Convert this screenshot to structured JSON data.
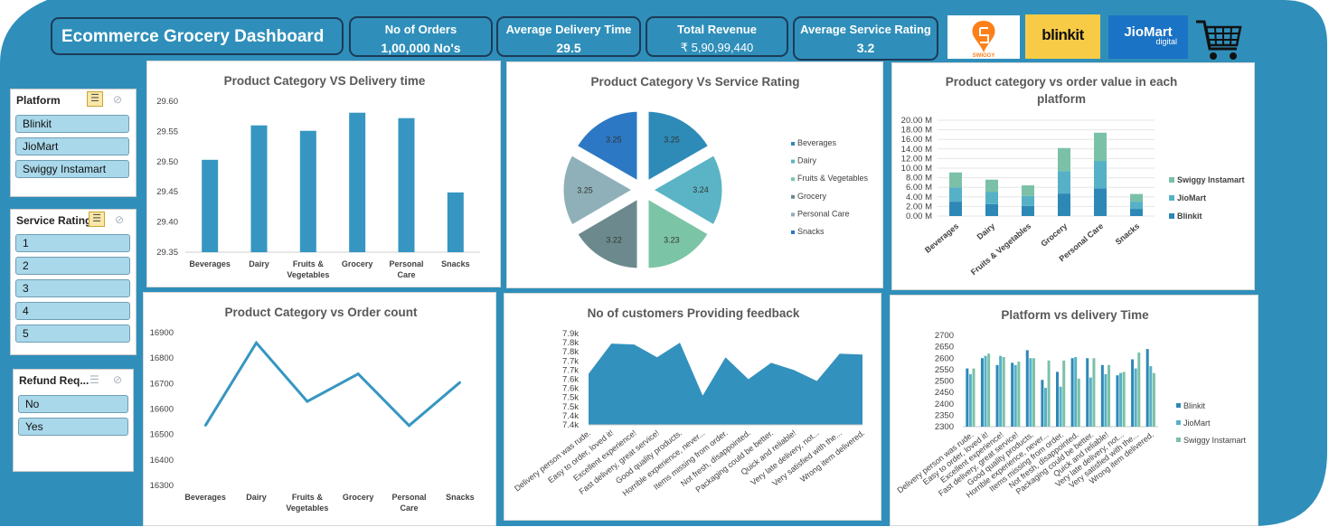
{
  "header": {
    "title": "Ecommerce Grocery Dashboard",
    "kpis": [
      {
        "label": "No of Orders",
        "value": "1,00,000 No's"
      },
      {
        "label": "Average Delivery Time",
        "value": "29.5"
      },
      {
        "label": "Total Revenue",
        "value": "₹ 5,90,99,440"
      },
      {
        "label": "Average Service Rating",
        "value": "3.2"
      }
    ],
    "logos": {
      "swiggy": "SWIGGY",
      "blinkit": "blinkit",
      "jiomart": "JioMart",
      "jiomart_sub": "digital"
    },
    "cart_icon": "shopping-cart-icon"
  },
  "slicers": {
    "platform": {
      "title": "Platform",
      "items": [
        "Blinkit",
        "JioMart",
        "Swiggy Instamart"
      ]
    },
    "service_rating": {
      "title": "Service Rating",
      "items": [
        "1",
        "2",
        "3",
        "4",
        "5"
      ]
    },
    "refund": {
      "title": "Refund Req...",
      "items": [
        "No",
        "Yes"
      ]
    }
  },
  "colors": {
    "accent": "#2f8fba",
    "dark": "#1c3b58",
    "bar": "#3696c1",
    "slicer_item": "#a9d8ea"
  },
  "chart_data": [
    {
      "type": "bar",
      "title": "Product Category VS Delivery time",
      "categories": [
        "Beverages",
        "Dairy",
        "Fruits & Vegetables",
        "Grocery",
        "Personal Care",
        "Snacks"
      ],
      "values": [
        29.503,
        29.56,
        29.551,
        29.581,
        29.572,
        29.449
      ],
      "ylim": [
        29.35,
        29.6
      ],
      "yticks": [
        "29.60",
        "29.55",
        "29.50",
        "29.45",
        "29.40",
        "29.35"
      ],
      "grid": false
    },
    {
      "type": "pie",
      "title": "Product Category Vs Service Rating",
      "categories": [
        "Beverages",
        "Dairy",
        "Fruits & Vegetables",
        "Grocery",
        "Personal Care",
        "Snacks"
      ],
      "values": [
        3.25,
        3.24,
        3.23,
        3.22,
        3.25,
        3.25
      ],
      "labels": [
        "3.25",
        "3.24",
        "3.23",
        "3.22",
        "3.25",
        "3.25"
      ],
      "colors": [
        "#2e8bb8",
        "#5ab4c5",
        "#7cc4a6",
        "#6c8a8e",
        "#8fb0b8",
        "#2c78c4"
      ],
      "legend": "right"
    },
    {
      "type": "bar",
      "stacked": true,
      "title": "Product category vs order value in each platform",
      "categories": [
        "Beverages",
        "Dairy",
        "Fruits & Vegetables",
        "Grocery",
        "Personal Care",
        "Snacks"
      ],
      "series": [
        {
          "name": "Blinkit",
          "values": [
            3.0,
            2.5,
            2.1,
            4.7,
            5.8,
            1.5
          ]
        },
        {
          "name": "JioMart",
          "values": [
            3.0,
            2.5,
            2.1,
            4.7,
            5.7,
            1.5
          ]
        },
        {
          "name": "Swiggy Instamart",
          "values": [
            3.1,
            2.6,
            2.2,
            4.8,
            5.9,
            1.6
          ]
        }
      ],
      "colors": [
        "#2e88b6",
        "#56b1c7",
        "#7bc1a7"
      ],
      "ylim": [
        0,
        20
      ],
      "yticks": [
        "20.00 M",
        "18.00 M",
        "16.00 M",
        "14.00 M",
        "12.00 M",
        "10.00 M",
        "8.00 M",
        "6.00 M",
        "4.00 M",
        "2.00 M",
        "0.00 M"
      ],
      "legend": "right"
    },
    {
      "type": "line",
      "title": "Product Category vs Order count",
      "categories": [
        "Beverages",
        "Dairy",
        "Fruits & Vegetables",
        "Grocery",
        "Personal Care",
        "Snacks"
      ],
      "values": [
        16535,
        16860,
        16630,
        16738,
        16535,
        16705
      ],
      "ylim": [
        16300,
        16900
      ],
      "yticks": [
        "16900",
        "16800",
        "16700",
        "16600",
        "16500",
        "16400",
        "16300"
      ]
    },
    {
      "type": "area",
      "title": "No of customers Providing feedback",
      "categories": [
        "Delivery person was rude.",
        "Easy to order, loved it!",
        "Excellent experience!",
        "Fast delivery, great service!",
        "Good quality products.",
        "Horrible experience, never...",
        "Items missing from order.",
        "Not fresh, disappointed.",
        "Packaging could be better.",
        "Quick and reliable!",
        "Very late delivery, not...",
        "Very satisfied with the...",
        "Wrong item delivered."
      ],
      "values": [
        7680,
        7845,
        7840,
        7770,
        7850,
        7560,
        7770,
        7650,
        7740,
        7700,
        7640,
        7790,
        7785
      ],
      "ylim": [
        7400,
        7900
      ],
      "yticks": [
        "7.9k",
        "7.8k",
        "7.8k",
        "7.7k",
        "7.7k",
        "7.6k",
        "7.6k",
        "7.5k",
        "7.5k",
        "7.4k",
        "7.4k"
      ]
    },
    {
      "type": "bar",
      "title": "Platform vs delivery Time",
      "categories": [
        "Delivery person was rude.",
        "Easy to order, loved it!",
        "Excellent experience!",
        "Fast delivery, great service!",
        "Good quality products.",
        "Horrible experience, never...",
        "Items missing from order.",
        "Not fresh, disappointed.",
        "Packaging could be better.",
        "Quick and reliable!",
        "Very late delivery, not...",
        "Very satisfied with the...",
        "Wrong item delivered."
      ],
      "series": [
        {
          "name": "Blinkit",
          "values": [
            2555,
            2600,
            2570,
            2580,
            2635,
            2505,
            2540,
            2600,
            2600,
            2570,
            2525,
            2595,
            2640
          ]
        },
        {
          "name": "JioMart",
          "values": [
            2530,
            2610,
            2610,
            2570,
            2600,
            2470,
            2475,
            2605,
            2515,
            2530,
            2535,
            2555,
            2565
          ]
        },
        {
          "name": "Swiggy Instamart",
          "values": [
            2555,
            2620,
            2605,
            2585,
            2600,
            2590,
            2590,
            2510,
            2600,
            2570,
            2540,
            2625,
            2535
          ]
        }
      ],
      "colors": [
        "#2e88b6",
        "#56b1c7",
        "#7bc1a7"
      ],
      "ylim": [
        2300,
        2700
      ],
      "yticks": [
        "2700",
        "2650",
        "2600",
        "2550",
        "2500",
        "2450",
        "2400",
        "2350",
        "2300"
      ],
      "legend": "right"
    }
  ]
}
